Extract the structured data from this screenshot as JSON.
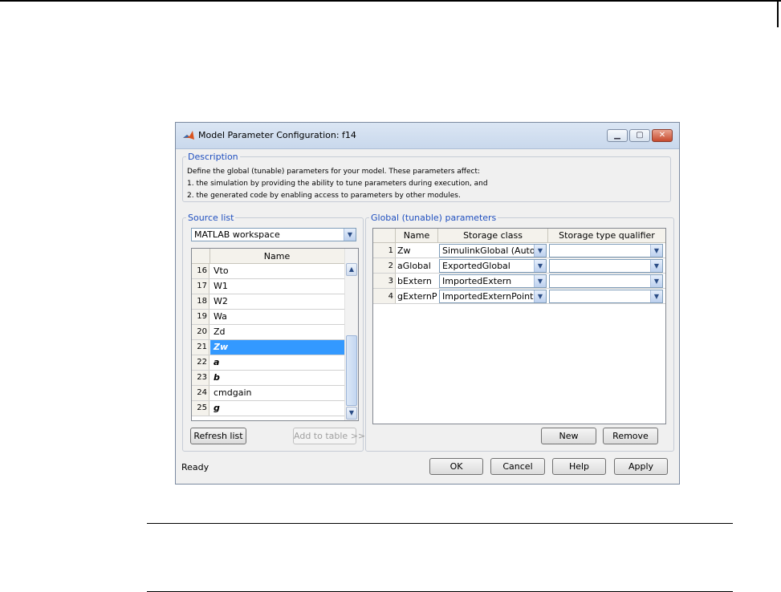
{
  "window": {
    "title": "Model Parameter Configuration: f14",
    "minimize_label": "▁",
    "maximize_label": "▢",
    "close_label": "✕"
  },
  "description": {
    "legend": "Description",
    "line1": "Define the global (tunable) parameters for your model. These parameters affect:",
    "line2": "1. the simulation by providing the ability to tune parameters during execution, and",
    "line3": "2. the generated code by enabling access to parameters by other modules."
  },
  "source_list": {
    "legend": "Source list",
    "source": "MATLAB workspace",
    "column_header": "Name",
    "rows": [
      {
        "num": "16",
        "name": "Vto"
      },
      {
        "num": "17",
        "name": "W1"
      },
      {
        "num": "18",
        "name": "W2"
      },
      {
        "num": "19",
        "name": "Wa"
      },
      {
        "num": "20",
        "name": "Zd"
      },
      {
        "num": "21",
        "name": "Zw"
      },
      {
        "num": "22",
        "name": "a"
      },
      {
        "num": "23",
        "name": "b"
      },
      {
        "num": "24",
        "name": "cmdgain"
      },
      {
        "num": "25",
        "name": "g"
      }
    ],
    "selected_row": "21",
    "refresh_button": "Refresh list",
    "add_button": "Add to table >>"
  },
  "global_params": {
    "legend": "Global (tunable) parameters",
    "headers": [
      "Name",
      "Storage class",
      "Storage type qualifier"
    ],
    "rows": [
      {
        "num": "1",
        "name": "Zw",
        "storage_class": "SimulinkGlobal (Auto)",
        "qualifier": ""
      },
      {
        "num": "2",
        "name": "aGlobal",
        "storage_class": "ExportedGlobal",
        "qualifier": ""
      },
      {
        "num": "3",
        "name": "bExtern",
        "storage_class": "ImportedExtern",
        "qualifier": ""
      },
      {
        "num": "4",
        "name": "gExternP",
        "storage_class": "ImportedExternPoint...",
        "qualifier": ""
      }
    ],
    "new_button": "New",
    "remove_button": "Remove"
  },
  "status": "Ready",
  "footer": {
    "ok": "OK",
    "cancel": "Cancel",
    "help": "Help",
    "apply": "Apply"
  },
  "colors": {
    "selection": "#3399ff",
    "legend_text": "#1f4fbf"
  }
}
